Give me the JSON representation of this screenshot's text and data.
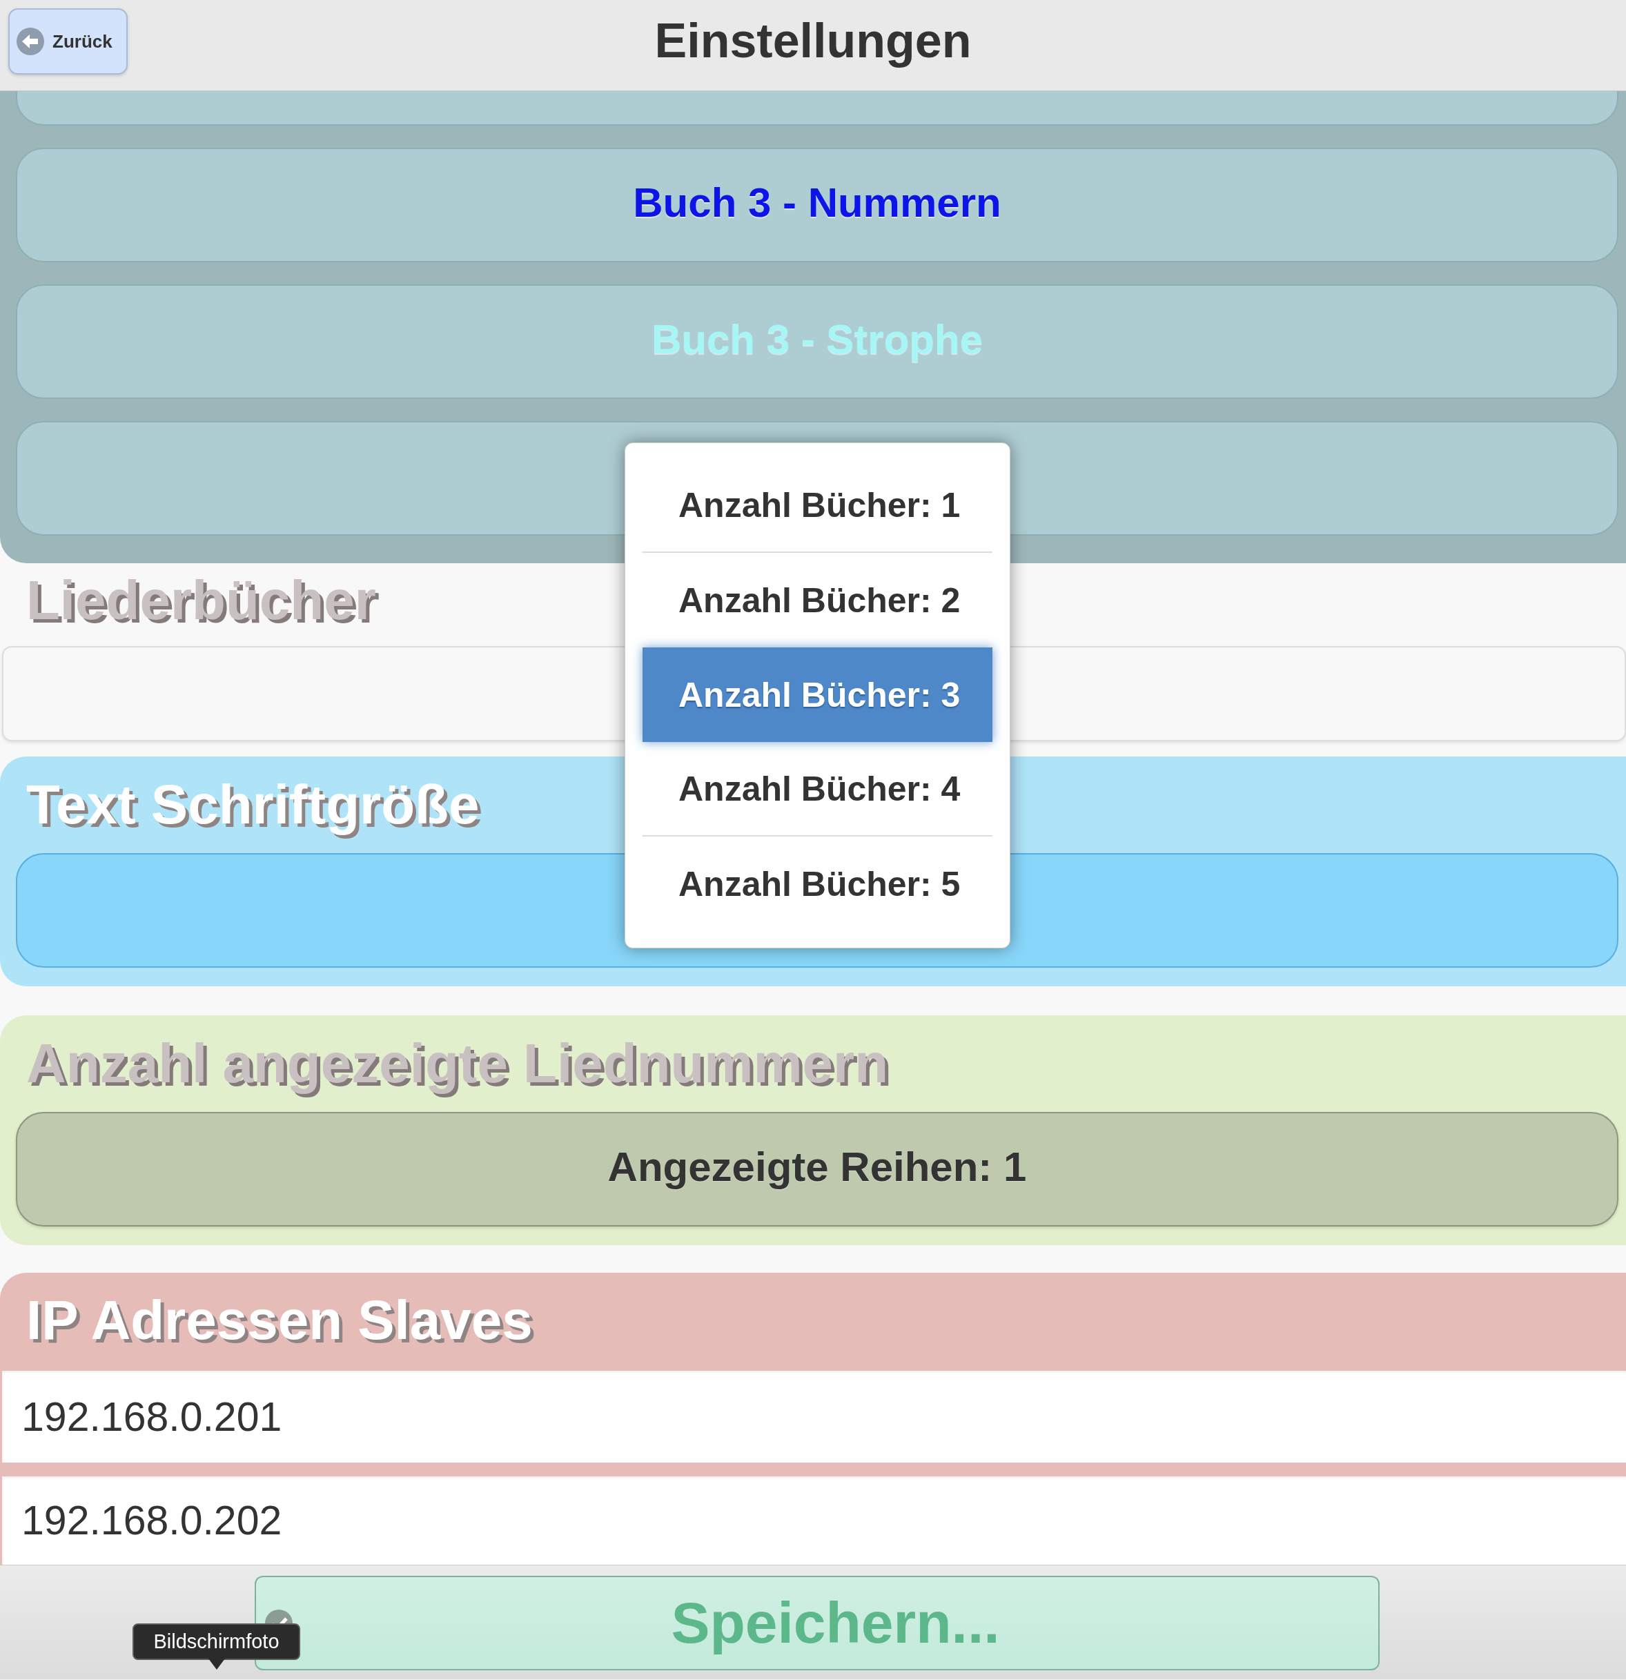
{
  "header": {
    "back_button": "Zurück",
    "title": "Einstellungen"
  },
  "book_section": {
    "buttons": [
      {
        "kind": "cut_off"
      },
      {
        "kind": "full",
        "label": "Buch 3 - Nummern",
        "color": "#0c14e8"
      },
      {
        "kind": "full",
        "label": "Buch 3 - Strophe",
        "color": "#a6f6f6"
      },
      {
        "kind": "full"
      }
    ]
  },
  "songbooks": {
    "title": "Liederbücher"
  },
  "dropdown_menu": {
    "options": [
      {
        "label": "Anzahl Bücher: 1",
        "selected": false
      },
      {
        "label": "Anzahl Bücher: 2",
        "selected": false
      },
      {
        "label": "Anzahl Bücher: 3",
        "selected": true
      },
      {
        "label": "Anzahl Bücher: 4",
        "selected": false
      },
      {
        "label": "Anzahl Bücher: 5",
        "selected": false
      }
    ]
  },
  "font_size": {
    "title": "Text Schriftgröße"
  },
  "displayed_numbers": {
    "title": "Anzahl angezeigte Liednummern",
    "select": "Angezeigte Reihen: 1"
  },
  "slave_ips": {
    "title": "IP Adressen Slaves",
    "fields": [
      {
        "value": "192.168.0.201"
      },
      {
        "value": "192.168.0.202"
      }
    ]
  },
  "save_button": "Speichern...",
  "tooltip": {
    "text": "Bildschirmfoto"
  }
}
